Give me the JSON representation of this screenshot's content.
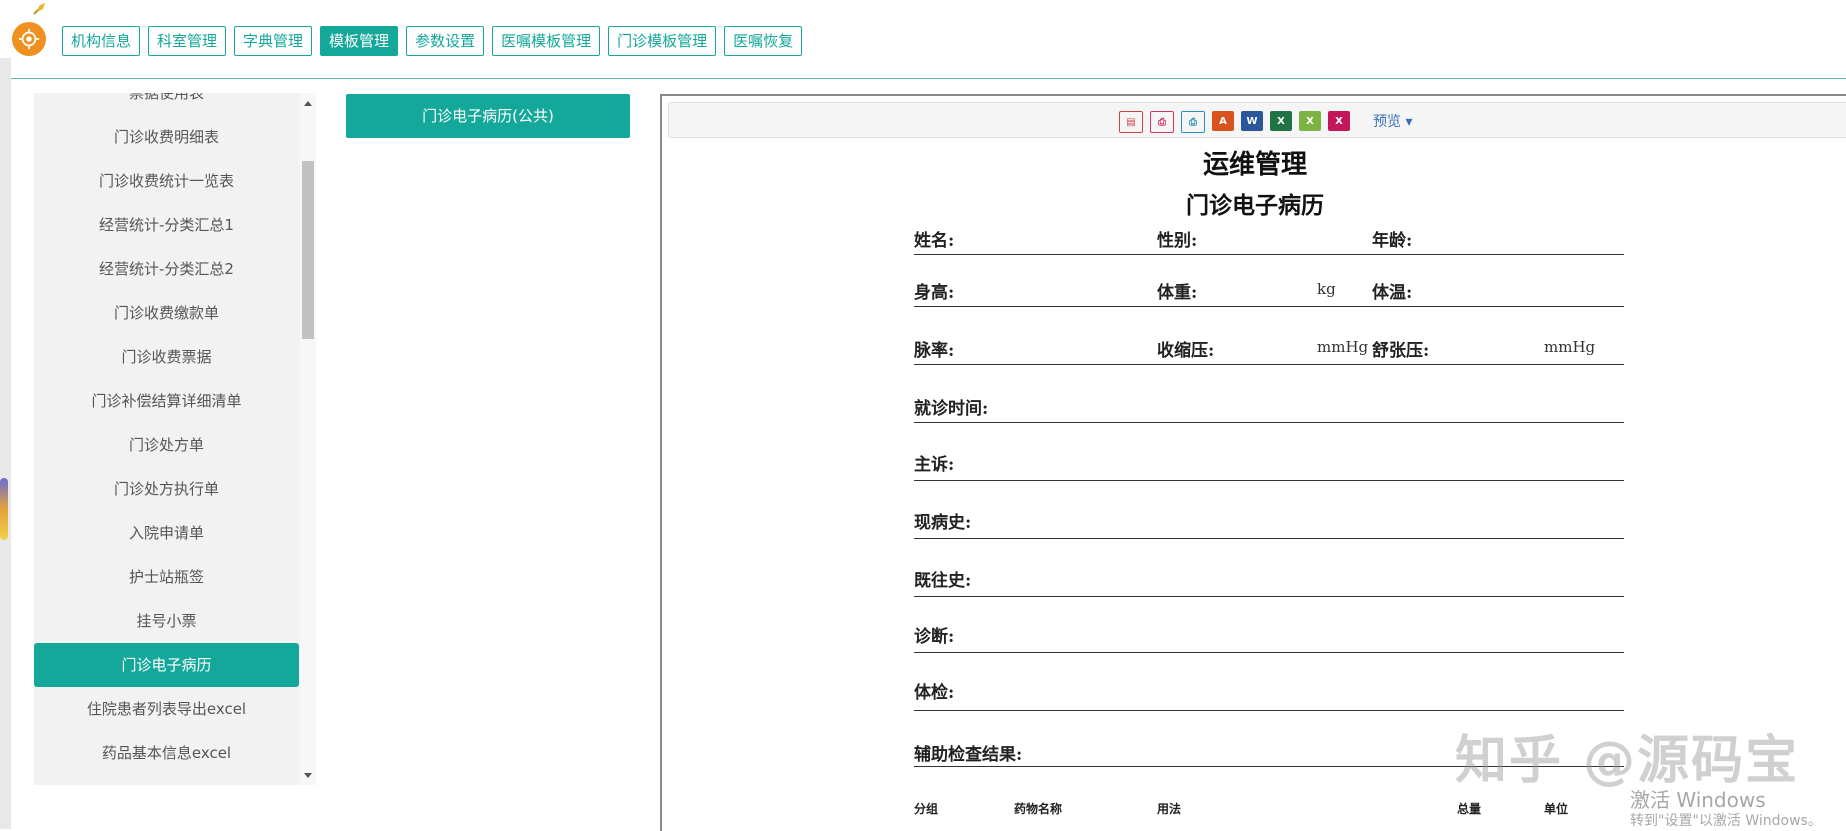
{
  "nav": {
    "items": [
      {
        "label": "机构信息",
        "active": false
      },
      {
        "label": "科室管理",
        "active": false
      },
      {
        "label": "字典管理",
        "active": false
      },
      {
        "label": "模板管理",
        "active": true
      },
      {
        "label": "参数设置",
        "active": false
      },
      {
        "label": "医嘱模板管理",
        "active": false
      },
      {
        "label": "门诊模板管理",
        "active": false
      },
      {
        "label": "医嘱恢复",
        "active": false
      }
    ]
  },
  "sidebar": {
    "items": [
      {
        "label": "票据使用表",
        "active": false
      },
      {
        "label": "门诊收费明细表",
        "active": false
      },
      {
        "label": "门诊收费统计一览表",
        "active": false
      },
      {
        "label": "经营统计-分类汇总1",
        "active": false
      },
      {
        "label": "经营统计-分类汇总2",
        "active": false
      },
      {
        "label": "门诊收费缴款单",
        "active": false
      },
      {
        "label": "门诊收费票据",
        "active": false
      },
      {
        "label": "门诊补偿结算详细清单",
        "active": false
      },
      {
        "label": "门诊处方单",
        "active": false
      },
      {
        "label": "门诊处方执行单",
        "active": false
      },
      {
        "label": "入院申请单",
        "active": false
      },
      {
        "label": "护士站瓶签",
        "active": false
      },
      {
        "label": "挂号小票",
        "active": false
      },
      {
        "label": "门诊电子病历",
        "active": true
      },
      {
        "label": "住院患者列表导出excel",
        "active": false
      },
      {
        "label": "药品基本信息excel",
        "active": false
      }
    ]
  },
  "template_list": {
    "selected": "门诊电子病历(公共)"
  },
  "toolbar": {
    "icons": [
      "page-setup-icon",
      "print-icon",
      "print-preview-icon",
      "pdf-icon",
      "word-icon",
      "excel-icon",
      "excel-alt-icon",
      "onenote-icon"
    ],
    "preview_label": "预览"
  },
  "document": {
    "title": "运维管理",
    "subtitle": "门诊电子病历",
    "fields": {
      "name": "姓名:",
      "gender": "性别:",
      "age": "年龄:",
      "height": "身高:",
      "weight": "体重:",
      "weight_unit": "kg",
      "temperature": "体温:",
      "pulse": "脉率:",
      "systolic": "收缩压:",
      "systolic_unit": "mmHg",
      "diastolic": "舒张压:",
      "diastolic_unit": "mmHg",
      "visit_time": "就诊时间:",
      "chief_complaint": "主诉:",
      "present_illness": "现病史:",
      "past_history": "既往史:",
      "diagnosis": "诊断:",
      "physical_exam": "体检:",
      "aux_results": "辅助检查结果:"
    },
    "rx_columns": [
      "分组",
      "药物名称",
      "用法",
      "总量",
      "单位"
    ]
  },
  "watermark": "知乎 @源码宝",
  "activation": {
    "line1": "激活 Windows",
    "line2": "转到\"设置\"以激活 Windows。"
  }
}
